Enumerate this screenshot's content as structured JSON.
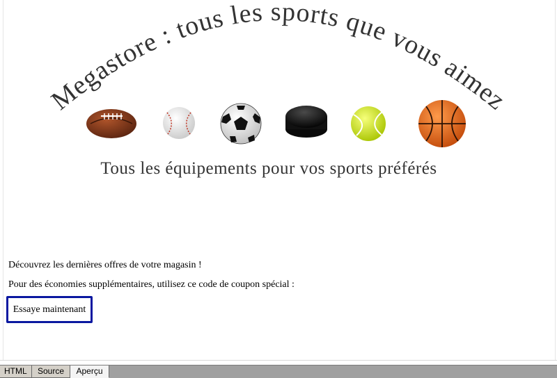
{
  "banner": {
    "arc_title": "Megastore : tous les sports que vous aimez",
    "tagline": "Tous les équipements pour vos sports préférés",
    "balls": [
      {
        "icon": "american-football-icon"
      },
      {
        "icon": "baseball-icon"
      },
      {
        "icon": "soccer-ball-icon"
      },
      {
        "icon": "hockey-puck-icon"
      },
      {
        "icon": "tennis-ball-icon"
      },
      {
        "icon": "basketball-icon"
      }
    ]
  },
  "content": {
    "offer_text": "Découvrez les dernières offres de votre magasin !",
    "coupon_text": "Pour des économies supplémentaires, utilisez ce code de coupon spécial :",
    "cta_label": "Essaye maintenant",
    "cta_border_color": "#0a18a0"
  },
  "view_tabs": {
    "html": "HTML",
    "source": "Source",
    "apercu": "Aperçu",
    "active": "Aperçu"
  }
}
